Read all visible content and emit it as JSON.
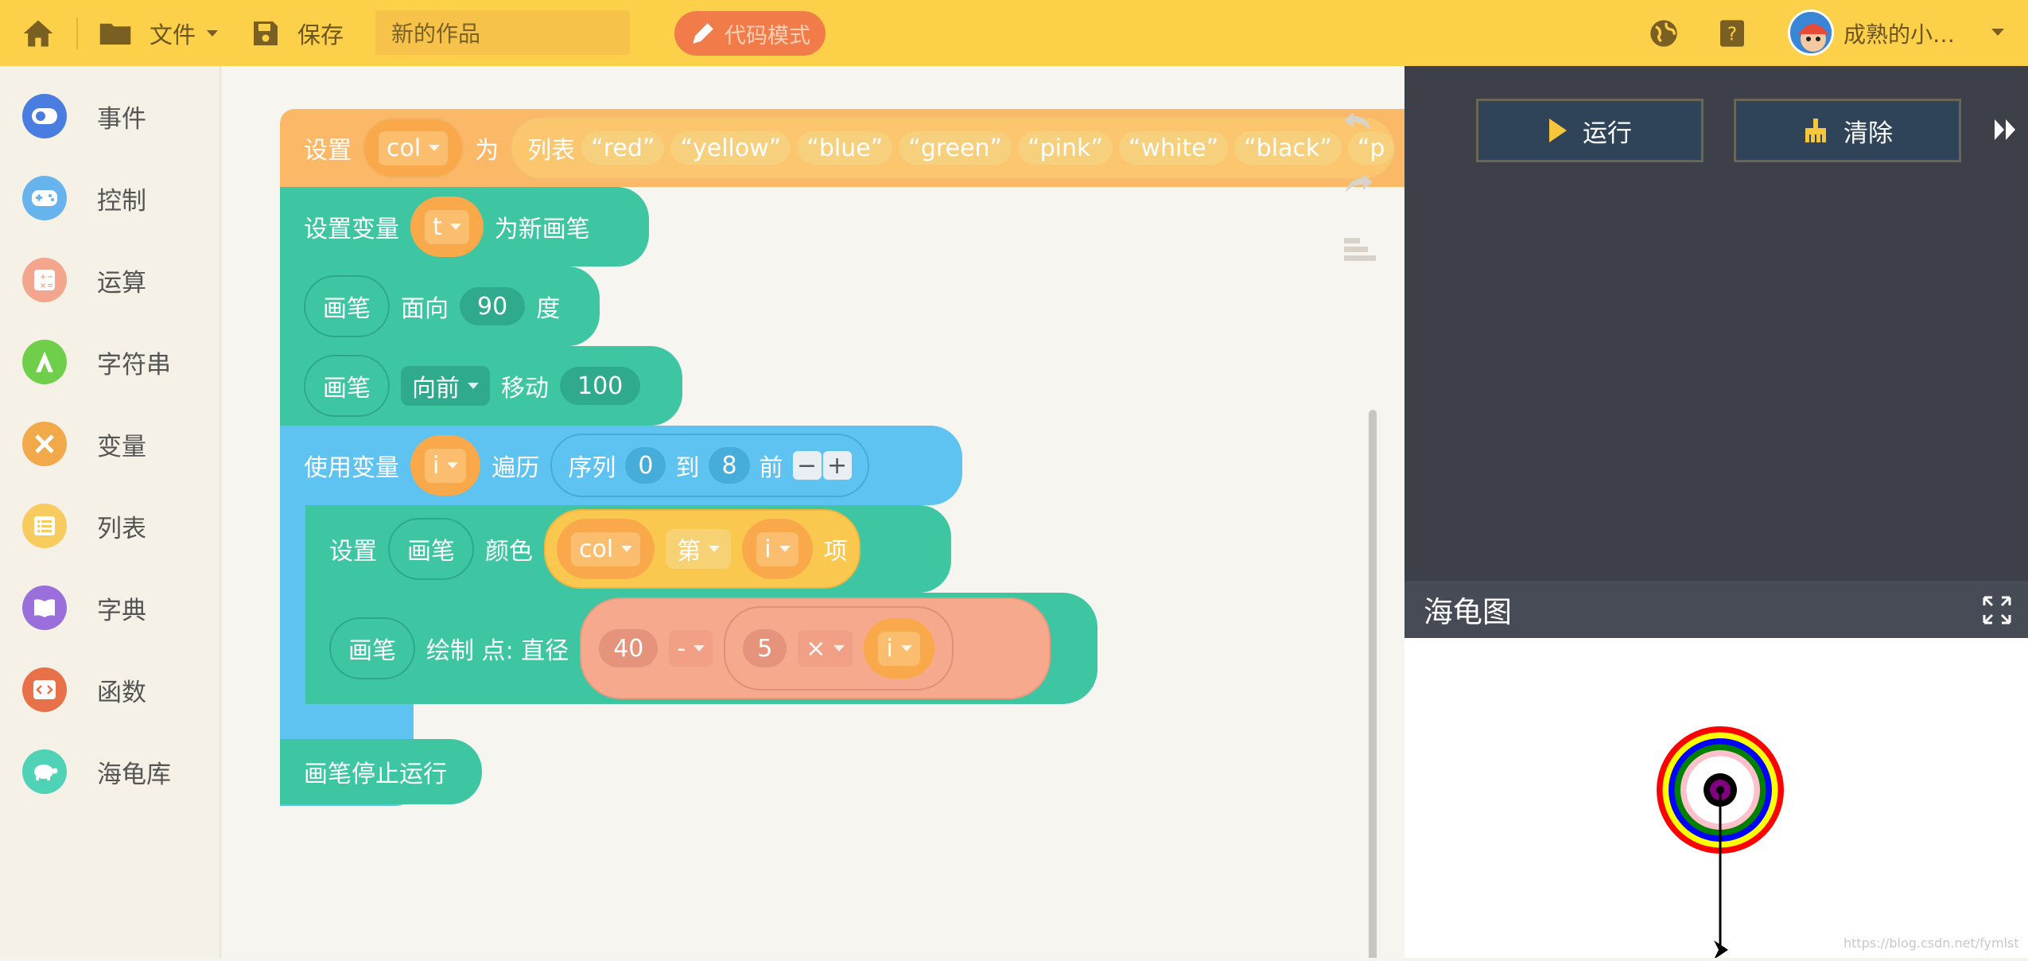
{
  "topbar": {
    "file_label": "文件",
    "save_label": "保存",
    "project_name": "新的作品",
    "code_mode_label": "代码模式",
    "username": "成熟的小…"
  },
  "sidebar": {
    "items": [
      {
        "label": "事件",
        "color": "#4a7de0"
      },
      {
        "label": "控制",
        "color": "#67b3ee"
      },
      {
        "label": "运算",
        "color": "#f3a68d"
      },
      {
        "label": "字符串",
        "color": "#6fcf4a"
      },
      {
        "label": "变量",
        "color": "#f2a94a"
      },
      {
        "label": "列表",
        "color": "#f7cb5d"
      },
      {
        "label": "字典",
        "color": "#9a6fdc"
      },
      {
        "label": "函数",
        "color": "#e8714a"
      },
      {
        "label": "海龟库",
        "color": "#4fd2b6"
      }
    ]
  },
  "blocks": {
    "b1": {
      "set": "设置",
      "var": "col",
      "as": "为",
      "list": "列表",
      "items": [
        "red",
        "yellow",
        "blue",
        "green",
        "pink",
        "white",
        "black",
        "p"
      ]
    },
    "b2": {
      "label": "设置变量",
      "var": "t",
      "suffix": "为新画笔"
    },
    "b3": {
      "pen": "画笔",
      "face": "面向",
      "deg": "90",
      "unit": "度"
    },
    "b4": {
      "pen": "画笔",
      "dir": "向前",
      "move": "移动",
      "dist": "100"
    },
    "b5": {
      "use": "使用变量",
      "var": "i",
      "iterate": "遍历",
      "seq": "序列",
      "from": "0",
      "to": "到",
      "to_val": "8",
      "before": "前"
    },
    "b6": {
      "set": "设置",
      "pen": "画笔",
      "color": "颜色",
      "list": "col",
      "nth": "第",
      "idx": "i",
      "item": "项"
    },
    "b7": {
      "pen": "画笔",
      "draw": "绘制 点: 直径",
      "a": "40",
      "minus": "-",
      "b": "5",
      "times": "×",
      "c": "i"
    },
    "b8": {
      "label": "画笔停止运行"
    }
  },
  "run_label": "运行",
  "clear_label": "清除",
  "turtle_title": "海龟图",
  "watermark": "https://blog.csdn.net/fymlst",
  "rings": [
    "red",
    "yellow",
    "blue",
    "green",
    "pink",
    "white",
    "black",
    "purple"
  ]
}
